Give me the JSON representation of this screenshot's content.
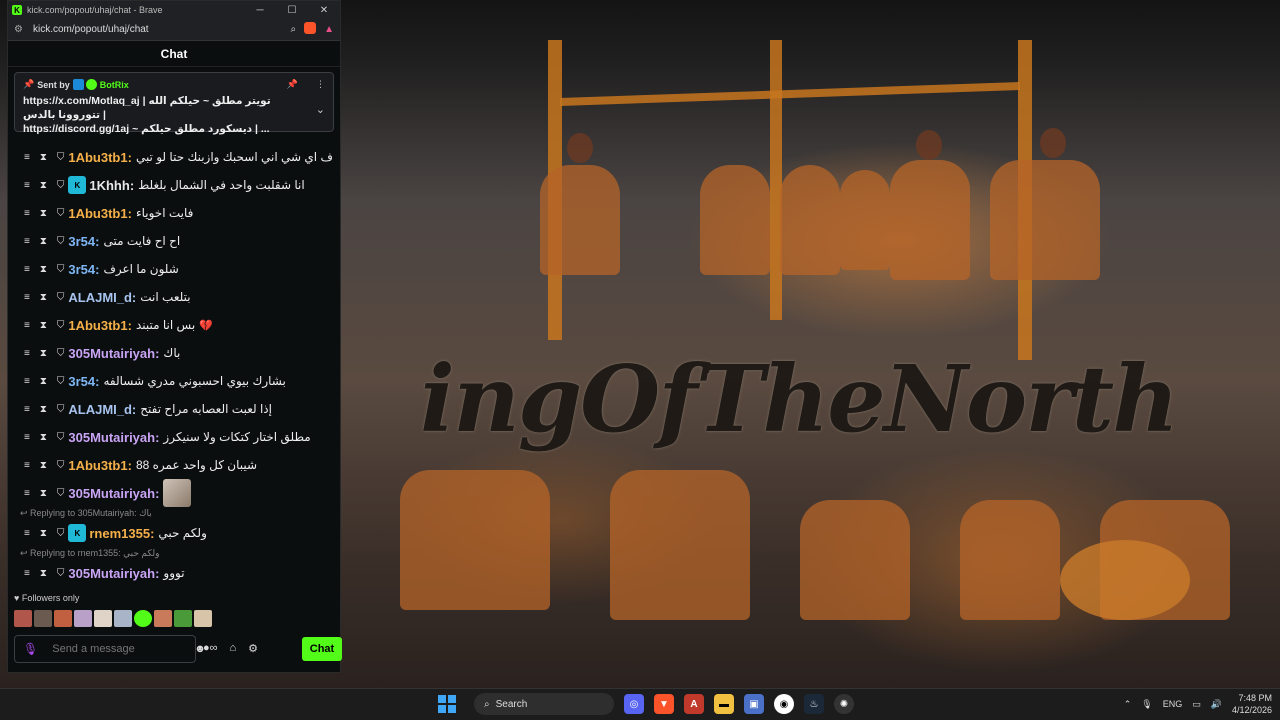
{
  "browser": {
    "title": "kick.com/popout/uhaj/chat - Brave",
    "url": "kick.com/popout/uhaj/chat",
    "minimize": "─",
    "maximize": "☐",
    "close": "✕"
  },
  "chat": {
    "header": "Chat",
    "pinned": {
      "sent_by_label": "Sent by",
      "author": "BotRix",
      "line1": "https://x.com/Motlaq_aj | تويتر مطلق ~ حيلكم الله تتوروونا بالدس |",
      "line2": "https://discord.gg/1aj ~ ديسكورد مطلق حيلكم | ..."
    },
    "messages": [
      {
        "user": "1Abu3tb1:",
        "color": "#f5b04a",
        "text": "ف اي شي اني اسحبك وازبنك حتا لو تبي",
        "kick_badge": false
      },
      {
        "user": "1Khhh:",
        "color": "#e8e8e8",
        "text": "انا شقلبت واحد في الشمال بلغلط",
        "kick_badge": true
      },
      {
        "user": "1Abu3tb1:",
        "color": "#f5b04a",
        "text": "فايت اخوياء",
        "kick_badge": false
      },
      {
        "user": "3r54:",
        "color": "#7eb6f5",
        "text": "اح اح فايت متى",
        "kick_badge": false
      },
      {
        "user": "3r54:",
        "color": "#7eb6f5",
        "text": "شلون ما اعرف",
        "kick_badge": false
      },
      {
        "user": "ALAJMI_d:",
        "color": "#a8c4f0",
        "text": "بتلعب انت",
        "kick_badge": false
      },
      {
        "user": "1Abu3tb1:",
        "color": "#f5b04a",
        "text": "بس انا متبند",
        "kick_badge": false,
        "heart": true
      },
      {
        "user": "305Mutairiyah:",
        "color": "#c9a4f5",
        "text": "باك",
        "kick_badge": false
      },
      {
        "user": "3r54:",
        "color": "#7eb6f5",
        "text": "بشارك بيوي احسبوني مدري شسالفه",
        "kick_badge": false
      },
      {
        "user": "ALAJMI_d:",
        "color": "#a8c4f0",
        "text": "إذا لعبت العصابه مراح تفتح",
        "kick_badge": false
      },
      {
        "user": "305Mutairiyah:",
        "color": "#c9a4f5",
        "text": "مطلق اختار كتكات ولا سنيكرز",
        "kick_badge": false
      },
      {
        "user": "1Abu3tb1:",
        "color": "#f5b04a",
        "text": "شيبان كل واحد عمره 88",
        "kick_badge": false
      },
      {
        "user": "305Mutairiyah:",
        "color": "#c9a4f5",
        "text": "",
        "kick_badge": false,
        "emote": true
      }
    ],
    "reply1": {
      "hint": "Replying to 305Mutairiyah: باك",
      "user": "rnem1355:",
      "color": "#f5b04a",
      "text": "ولكم حبي"
    },
    "reply2": {
      "hint": "Replying to rnem1355: ولكم حبي",
      "user": "305Mutairiyah:",
      "color": "#c9a4f5",
      "text": "تووو"
    },
    "followers_only": "Followers only",
    "input_placeholder": "Send a message",
    "send_label": "Chat"
  },
  "stream": {
    "logo_text": "ingOfTheNorth"
  },
  "taskbar": {
    "search_label": "Search",
    "language": "ENG",
    "time": "7:48 PM",
    "date": "4/12/2026"
  }
}
